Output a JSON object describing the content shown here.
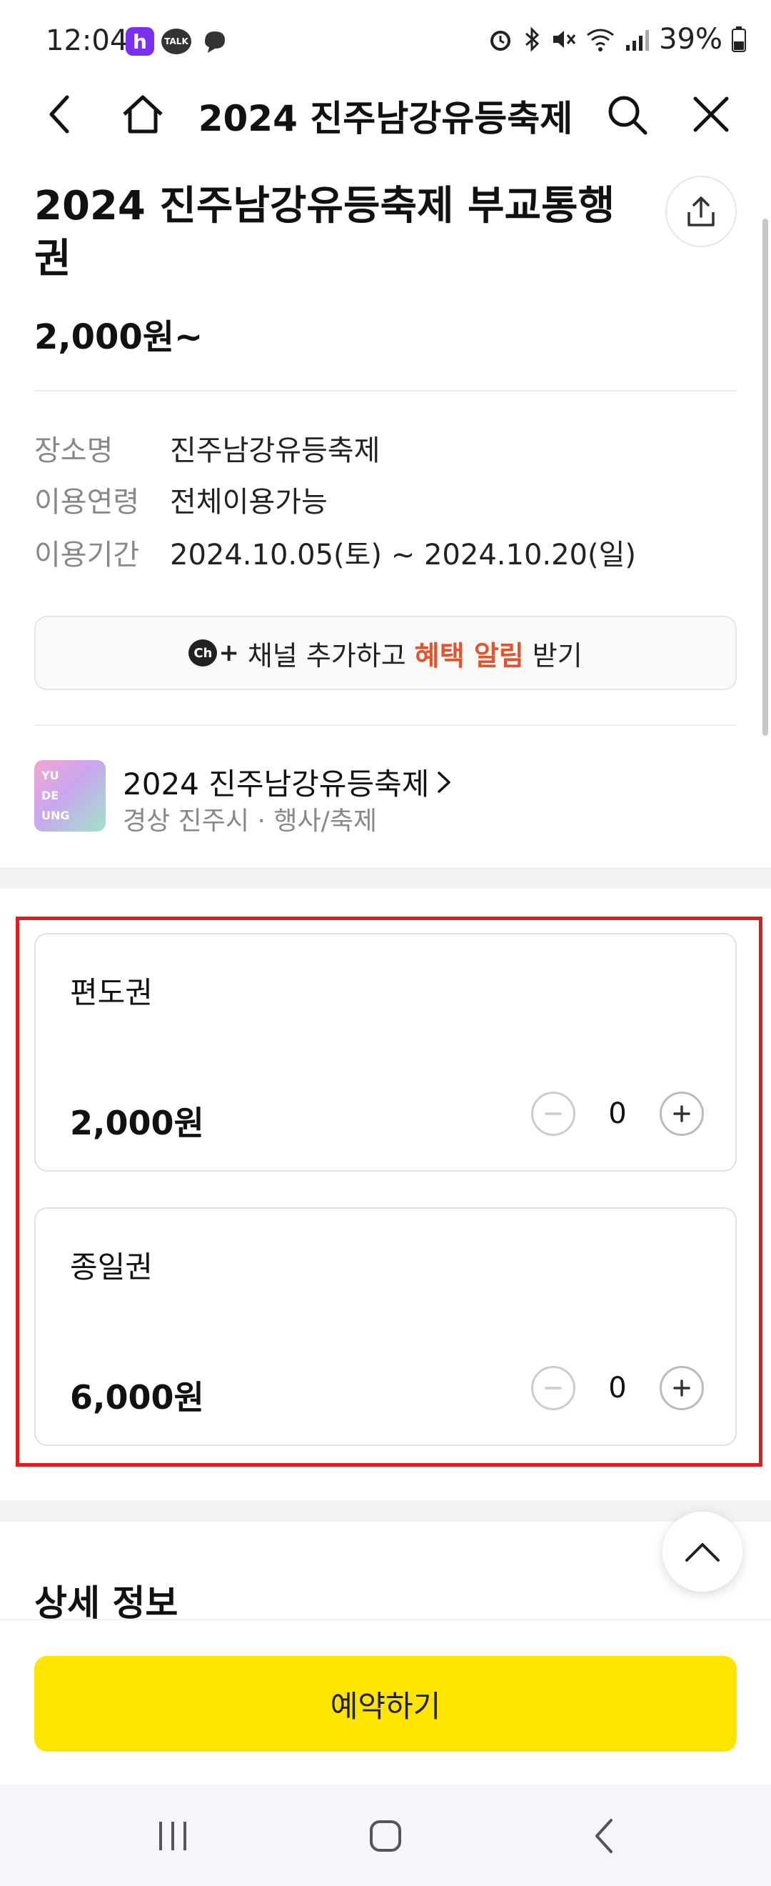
{
  "status_bar": {
    "time": "12:04",
    "battery": "39%",
    "app_h_letter": "h",
    "talk_label": "TALK"
  },
  "nav": {
    "title": "2024 진주남강유등축제"
  },
  "product": {
    "title": "2024 진주남강유등축제 부교통행권",
    "price": "2,000원~"
  },
  "info": [
    {
      "label": "장소명",
      "value": "진주남강유등축제"
    },
    {
      "label": "이용연령",
      "value": "전체이용가능"
    },
    {
      "label": "이용기간",
      "value": "2024.10.05(토) ~ 2024.10.20(일)"
    }
  ],
  "channel": {
    "icon_label": "Ch",
    "text_before": "채널 추가하고",
    "text_highlight": "혜택 알림",
    "text_after": "받기",
    "highlight_color": "#e5532d"
  },
  "venue": {
    "name": "2024 진주남강유등축제",
    "sub": "경상 진주시 · 행사/축제",
    "thumb_text": [
      "YU",
      "DE",
      "UNG"
    ]
  },
  "tickets": [
    {
      "name": "편도권",
      "price": "2,000원",
      "quantity": "0"
    },
    {
      "name": "종일권",
      "price": "6,000원",
      "quantity": "0"
    }
  ],
  "detail": {
    "title": "상세 정보"
  },
  "reserve_button": {
    "label": "예약하기",
    "color": "#fee500"
  },
  "colors": {
    "highlight_frame": "#d81e1e"
  }
}
